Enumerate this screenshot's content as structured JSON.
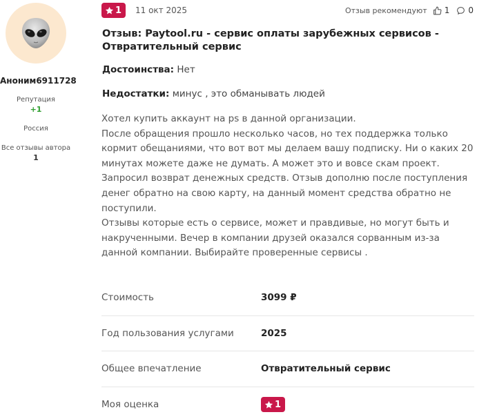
{
  "author": {
    "name": "Аноним6911728",
    "avatar_icon": "alien-emoji",
    "reputation_label": "Репутация",
    "reputation_value": "+1",
    "country": "Россия",
    "all_reviews_label": "Все отзывы автора",
    "all_reviews_count": "1"
  },
  "header": {
    "rating": "1",
    "date": "11 окт 2025",
    "recommend_label": "Отзыв рекомендуют",
    "likes": "1",
    "comments": "0"
  },
  "review": {
    "title": "Отзыв: Paytool.ru - сервис оплаты зарубежных сервисов - Отвратительный сервис",
    "pros_label": "Достоинства:",
    "pros": "Нет",
    "cons_label": "Недостатки:",
    "cons": "минус , это обманывать людей",
    "body": "Хотел купить аккаунт на ps в данной организации.\nПосле обращения прошло несколько часов, но тех поддержка только кормит обещаниями, что вот вот мы делаем вашу подписку. Ни о каких 20 минутах можете даже не думать. А может это и вовсе скам проект.\nЗапросил возврат денежных средств. Отзыв дополню после поступления денег обратно на свою карту, на данный момент средства обратно не поступили.\nОтзывы которые есть о сервисе, может и правдивые, но могут быть и накрученными. Вечер в компании друзей оказался сорванным из-за данной компании. Выбирайте проверенные сервисы ."
  },
  "details": {
    "cost_label": "Стоимость",
    "cost_value": "3099 ₽",
    "year_label": "Год пользования услугами",
    "year_value": "2025",
    "impression_label": "Общее впечатление",
    "impression_value": "Отвратительный сервис",
    "my_rating_label": "Моя оценка",
    "my_rating_value": "1"
  },
  "colors": {
    "rating_badge": "#c9184a",
    "reputation_positive": "#2e9e2e",
    "avatar_bg": "#fce8cf"
  }
}
